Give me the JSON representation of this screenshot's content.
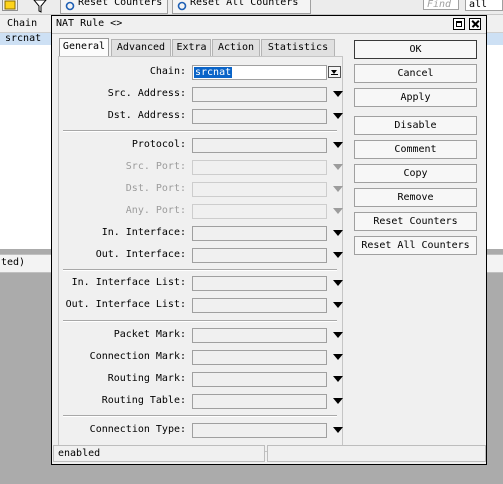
{
  "background": {
    "toolbar": {
      "reset_counters": "Reset Counters",
      "reset_all_counters": "Reset All Counters",
      "find_placeholder": "Find",
      "filter_value": "all"
    },
    "table": {
      "column_header": "Chain",
      "rows": [
        {
          "chain": "srcnat"
        }
      ]
    },
    "status_text": "ted)"
  },
  "dialog": {
    "title": "NAT Rule <>",
    "tabs": [
      {
        "label": "General",
        "active": true
      },
      {
        "label": "Advanced"
      },
      {
        "label": "Extra"
      },
      {
        "label": "Action"
      },
      {
        "label": "Statistics"
      }
    ],
    "fields": {
      "chain": {
        "label": "Chain:",
        "value": "srcnat"
      },
      "src_address": {
        "label": "Src. Address:"
      },
      "dst_address": {
        "label": "Dst. Address:"
      },
      "protocol": {
        "label": "Protocol:"
      },
      "src_port": {
        "label": "Src. Port:"
      },
      "dst_port": {
        "label": "Dst. Port:"
      },
      "any_port": {
        "label": "Any. Port:"
      },
      "in_interface": {
        "label": "In. Interface:"
      },
      "out_interface": {
        "label": "Out. Interface:"
      },
      "in_interface_list": {
        "label": "In. Interface List:"
      },
      "out_interface_list": {
        "label": "Out. Interface List:"
      },
      "packet_mark": {
        "label": "Packet Mark:"
      },
      "connection_mark": {
        "label": "Connection Mark:"
      },
      "routing_mark": {
        "label": "Routing Mark:"
      },
      "routing_table": {
        "label": "Routing Table:"
      },
      "connection_type": {
        "label": "Connection Type:"
      }
    },
    "buttons": {
      "ok": "OK",
      "cancel": "Cancel",
      "apply": "Apply",
      "disable": "Disable",
      "comment": "Comment",
      "copy": "Copy",
      "remove": "Remove",
      "reset_counters": "Reset Counters",
      "reset_all_counters": "Reset All Counters"
    },
    "status": "enabled"
  }
}
